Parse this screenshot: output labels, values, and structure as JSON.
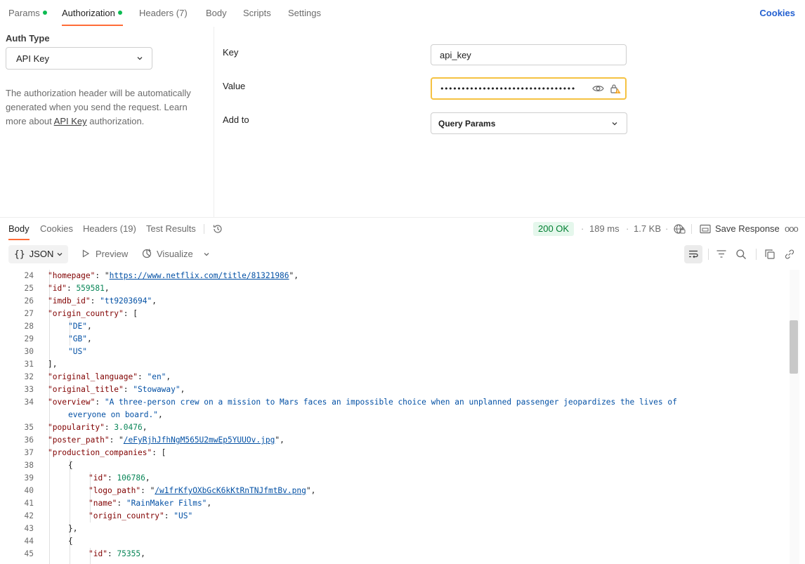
{
  "request_tabs": [
    {
      "label": "Params",
      "dot": true
    },
    {
      "label": "Authorization",
      "dot": true
    },
    {
      "label": "Headers",
      "count": "(7)"
    },
    {
      "label": "Body"
    },
    {
      "label": "Scripts"
    },
    {
      "label": "Settings"
    }
  ],
  "cookies_label": "Cookies",
  "auth": {
    "type_label": "Auth Type",
    "type_value": "API Key",
    "description_before": "The authorization header will be automatically generated when you send the request. Learn more about ",
    "description_link": "API Key",
    "description_after": " authorization.",
    "key_label": "Key",
    "key_value": "api_key",
    "value_label": "Value",
    "value_masked": "••••••••••••••••••••••••••••••••",
    "addto_label": "Add to",
    "addto_value": "Query Params"
  },
  "response_tabs": [
    {
      "label": "Body"
    },
    {
      "label": "Cookies"
    },
    {
      "label": "Headers (19)"
    },
    {
      "label": "Test Results"
    }
  ],
  "response_meta": {
    "status": "200 OK",
    "time": "189 ms",
    "size": "1.7 KB",
    "save_label": "Save Response",
    "more": "ooo",
    "meta_sep": "·"
  },
  "toolbar": {
    "format": "JSON",
    "format_braces": "{}",
    "preview": "Preview",
    "visualize": "Visualize"
  },
  "code_lines": [
    {
      "n": "24",
      "i": 1,
      "parts": [
        [
          "k",
          "\"homepage\""
        ],
        [
          "p",
          ": \""
        ],
        [
          "u",
          "https://www.netflix.com/title/81321986"
        ],
        [
          "p",
          "\","
        ]
      ]
    },
    {
      "n": "25",
      "i": 1,
      "parts": [
        [
          "k",
          "\"id\""
        ],
        [
          "p",
          ": "
        ],
        [
          "n",
          "559581"
        ],
        [
          "p",
          ","
        ]
      ]
    },
    {
      "n": "26",
      "i": 1,
      "parts": [
        [
          "k",
          "\"imdb_id\""
        ],
        [
          "p",
          ": "
        ],
        [
          "s",
          "\"tt9203694\""
        ],
        [
          "p",
          ","
        ]
      ]
    },
    {
      "n": "27",
      "i": 1,
      "parts": [
        [
          "k",
          "\"origin_country\""
        ],
        [
          "p",
          ": ["
        ]
      ]
    },
    {
      "n": "28",
      "i": 2,
      "parts": [
        [
          "s",
          "\"DE\""
        ],
        [
          "p",
          ","
        ]
      ]
    },
    {
      "n": "29",
      "i": 2,
      "parts": [
        [
          "s",
          "\"GB\""
        ],
        [
          "p",
          ","
        ]
      ]
    },
    {
      "n": "30",
      "i": 2,
      "parts": [
        [
          "s",
          "\"US\""
        ]
      ]
    },
    {
      "n": "31",
      "i": 1,
      "parts": [
        [
          "p",
          "],"
        ]
      ]
    },
    {
      "n": "32",
      "i": 1,
      "parts": [
        [
          "k",
          "\"original_language\""
        ],
        [
          "p",
          ": "
        ],
        [
          "s",
          "\"en\""
        ],
        [
          "p",
          ","
        ]
      ]
    },
    {
      "n": "33",
      "i": 1,
      "parts": [
        [
          "k",
          "\"original_title\""
        ],
        [
          "p",
          ": "
        ],
        [
          "s",
          "\"Stowaway\""
        ],
        [
          "p",
          ","
        ]
      ]
    },
    {
      "n": "34",
      "i": 1,
      "parts": [
        [
          "k",
          "\"overview\""
        ],
        [
          "p",
          ": "
        ],
        [
          "s",
          "\"A three-person crew on a mission to Mars faces an impossible choice when an unplanned passenger jeopardizes the lives of"
        ]
      ]
    },
    {
      "n": "",
      "i": 2,
      "parts": [
        [
          "s",
          "everyone on board.\""
        ],
        [
          "p",
          ","
        ]
      ]
    },
    {
      "n": "35",
      "i": 1,
      "parts": [
        [
          "k",
          "\"popularity\""
        ],
        [
          "p",
          ": "
        ],
        [
          "n",
          "3.0476"
        ],
        [
          "p",
          ","
        ]
      ]
    },
    {
      "n": "36",
      "i": 1,
      "parts": [
        [
          "k",
          "\"poster_path\""
        ],
        [
          "p",
          ": \""
        ],
        [
          "u",
          "/eFyRjhJfhNgM565U2mwEp5YUUOv.jpg"
        ],
        [
          "p",
          "\","
        ]
      ]
    },
    {
      "n": "37",
      "i": 1,
      "parts": [
        [
          "k",
          "\"production_companies\""
        ],
        [
          "p",
          ": ["
        ]
      ]
    },
    {
      "n": "38",
      "i": 2,
      "parts": [
        [
          "p",
          "{"
        ]
      ]
    },
    {
      "n": "39",
      "i": 3,
      "parts": [
        [
          "k",
          "\"id\""
        ],
        [
          "p",
          ": "
        ],
        [
          "n",
          "106786"
        ],
        [
          "p",
          ","
        ]
      ]
    },
    {
      "n": "40",
      "i": 3,
      "parts": [
        [
          "k",
          "\"logo_path\""
        ],
        [
          "p",
          ": \""
        ],
        [
          "u",
          "/w1frKfyOXbGcK6kKtRnTNJfmtBv.png"
        ],
        [
          "p",
          "\","
        ]
      ]
    },
    {
      "n": "41",
      "i": 3,
      "parts": [
        [
          "k",
          "\"name\""
        ],
        [
          "p",
          ": "
        ],
        [
          "s",
          "\"RainMaker Films\""
        ],
        [
          "p",
          ","
        ]
      ]
    },
    {
      "n": "42",
      "i": 3,
      "parts": [
        [
          "k",
          "\"origin_country\""
        ],
        [
          "p",
          ": "
        ],
        [
          "s",
          "\"US\""
        ]
      ]
    },
    {
      "n": "43",
      "i": 2,
      "parts": [
        [
          "p",
          "},"
        ]
      ]
    },
    {
      "n": "44",
      "i": 2,
      "parts": [
        [
          "p",
          "{"
        ]
      ]
    },
    {
      "n": "45",
      "i": 3,
      "parts": [
        [
          "k",
          "\"id\""
        ],
        [
          "p",
          ": "
        ],
        [
          "n",
          "75355"
        ],
        [
          "p",
          ","
        ]
      ]
    }
  ]
}
